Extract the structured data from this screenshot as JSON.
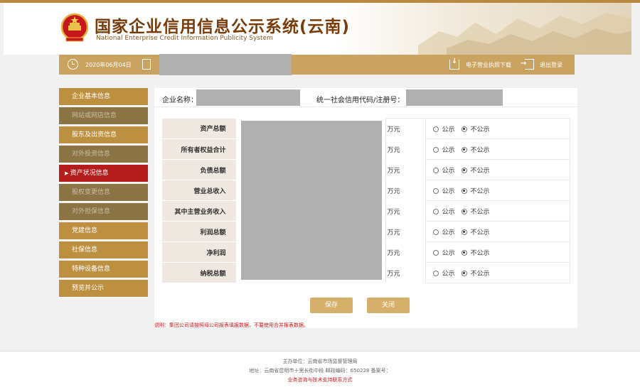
{
  "header": {
    "title_cn": "国家企业信用信息公示系统(云南)",
    "title_en": "National Enterprise Credit Information Publicity System"
  },
  "bar": {
    "date": "2020年06月04日",
    "download_label": "电子营业执照下载",
    "logout_label": "退出登录"
  },
  "sidebar": {
    "items": [
      {
        "label": "企业基本信息",
        "state": "normal"
      },
      {
        "label": "网站或网店信息",
        "state": "muted"
      },
      {
        "label": "股东及出资信息",
        "state": "normal"
      },
      {
        "label": "对外投资信息",
        "state": "muted"
      },
      {
        "label": "资产状况信息",
        "state": "active"
      },
      {
        "label": "股权变更信息",
        "state": "muted"
      },
      {
        "label": "对外担保信息",
        "state": "muted"
      },
      {
        "label": "党建信息",
        "state": "normal"
      },
      {
        "label": "社保信息",
        "state": "normal"
      },
      {
        "label": "特种设备信息",
        "state": "normal"
      },
      {
        "label": "预览并公示",
        "state": "normal"
      }
    ]
  },
  "main": {
    "company_name_label": "企业名称：",
    "credit_code_label": "统一社会信用代码/注册号：",
    "rows": [
      {
        "label": "资产总额",
        "unit": "万元",
        "public": "公示",
        "private": "不公示",
        "selected": "private"
      },
      {
        "label": "所有者权益合计",
        "unit": "万元",
        "public": "公示",
        "private": "不公示",
        "selected": "private"
      },
      {
        "label": "负债总额",
        "unit": "万元",
        "public": "公示",
        "private": "不公示",
        "selected": "private"
      },
      {
        "label": "营业总收入",
        "unit": "万元",
        "public": "公示",
        "private": "不公示",
        "selected": "private"
      },
      {
        "label": "其中主营业务收入",
        "unit": "万元",
        "public": "公示",
        "private": "不公示",
        "selected": "private"
      },
      {
        "label": "利润总额",
        "unit": "万元",
        "public": "公示",
        "private": "不公示",
        "selected": "private"
      },
      {
        "label": "净利润",
        "unit": "万元",
        "public": "公示",
        "private": "不公示",
        "selected": "private"
      },
      {
        "label": "纳税总额",
        "unit": "万元",
        "public": "公示",
        "private": "不公示",
        "selected": "private"
      }
    ],
    "save_label": "保存",
    "close_label": "关闭",
    "note": "说明：集团公司请按照母公司报表填报数据，不要使用合并报表数据。"
  },
  "footer": {
    "sponsor": "主办单位：云南省市场监督管理局",
    "address": "地址：云南省昆明市十里长街中段 邮政编码：650228 备案号：",
    "contact": "业务咨询与技术支持联系方式"
  },
  "colors": {
    "gold": "#c9a35f",
    "nav_gold": "#bd8f40",
    "nav_muted": "#8b7344",
    "active_red": "#b51d1d",
    "title_brown": "#7a3b0a"
  }
}
